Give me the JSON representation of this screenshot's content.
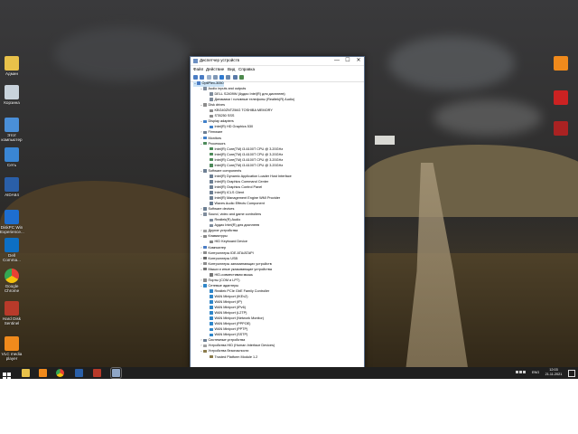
{
  "desktop": {
    "icons": [
      {
        "label": "Админ",
        "icon": "folder-icon",
        "color": "#e8c14a"
      },
      {
        "label": "Корзина",
        "icon": "recycle-bin-icon",
        "color": "#c9d3dc"
      },
      {
        "label": "Этот компьютер",
        "icon": "computer-icon",
        "color": "#4a8fd8"
      },
      {
        "label": "Сеть",
        "icon": "network-icon",
        "color": "#3a86d4"
      },
      {
        "label": "AIDA64",
        "icon": "aida64-icon",
        "color": "#2a5fa8"
      },
      {
        "label": "DiskPC Win Experience...",
        "icon": "diskpc-icon",
        "color": "#1e6ed0"
      },
      {
        "label": "Dell Comma...",
        "icon": "dell-icon",
        "color": "#0d6fc4"
      },
      {
        "label": "Google Chrome",
        "icon": "chrome-icon",
        "color": "#e84234"
      },
      {
        "label": "Hard Disk Sentinel",
        "icon": "hdd-sentinel-icon",
        "color": "#b83a2a"
      },
      {
        "label": "VLC media player",
        "icon": "vlc-icon",
        "color": "#f08a1c"
      }
    ],
    "right_icons": [
      {
        "label": "",
        "icon": "vlc-icon",
        "color": "#f08a1c"
      },
      {
        "label": "",
        "icon": "media-icon",
        "color": "#c22"
      },
      {
        "label": "",
        "icon": "app-icon",
        "color": "#a22"
      }
    ]
  },
  "window": {
    "title": "Диспетчер устройств",
    "menu": [
      "Файл",
      "Действие",
      "Вид",
      "Справка"
    ],
    "controls": {
      "minimize": "—",
      "maximize": "☐",
      "close": "✕"
    },
    "tree": [
      {
        "level": 0,
        "label": "OptiPlex-3050",
        "exp": "⌄",
        "icon": "computer-icon",
        "selected": true
      },
      {
        "level": 1,
        "label": "Audio inputs and outputs",
        "exp": "⌄",
        "icon": "speaker-icon"
      },
      {
        "level": 2,
        "label": "DELL S2409W (Аудио Intel(R) для дисплеев)",
        "exp": "",
        "icon": "speaker-icon"
      },
      {
        "level": 2,
        "label": "Динамики / головные телефоны (Realtek(R) Audio)",
        "exp": "",
        "icon": "speaker-icon"
      },
      {
        "level": 1,
        "label": "Disk drives",
        "exp": "⌄",
        "icon": "disk-icon"
      },
      {
        "level": 2,
        "label": "KBG40ZNT256G TOSHIBA MEMORY",
        "exp": "",
        "icon": "disk-icon"
      },
      {
        "level": 2,
        "label": "ST8250 SSS",
        "exp": "",
        "icon": "disk-icon"
      },
      {
        "level": 1,
        "label": "Display adapters",
        "exp": "⌄",
        "icon": "display-icon"
      },
      {
        "level": 2,
        "label": "Intel(R) HD Graphics 530",
        "exp": "",
        "icon": "display-icon"
      },
      {
        "level": 1,
        "label": "Firmware",
        "exp": "›",
        "icon": "chip-icon"
      },
      {
        "level": 1,
        "label": "Monitors",
        "exp": "›",
        "icon": "monitor-icon"
      },
      {
        "level": 1,
        "label": "Processors",
        "exp": "⌄",
        "icon": "cpu-icon"
      },
      {
        "level": 2,
        "label": "Intel(R) Core(TM) i3-6100T CPU @ 3.20GHz",
        "exp": "",
        "icon": "cpu-icon"
      },
      {
        "level": 2,
        "label": "Intel(R) Core(TM) i3-6100T CPU @ 3.20GHz",
        "exp": "",
        "icon": "cpu-icon"
      },
      {
        "level": 2,
        "label": "Intel(R) Core(TM) i3-6100T CPU @ 3.20GHz",
        "exp": "",
        "icon": "cpu-icon"
      },
      {
        "level": 2,
        "label": "Intel(R) Core(TM) i3-6100T CPU @ 3.20GHz",
        "exp": "",
        "icon": "cpu-icon"
      },
      {
        "level": 1,
        "label": "Software components",
        "exp": "⌄",
        "icon": "chip-icon"
      },
      {
        "level": 2,
        "label": "Intel(R) Dynamic Application Loader Host Interface",
        "exp": "",
        "icon": "chip-icon"
      },
      {
        "level": 2,
        "label": "Intel(R) Graphics Command Center",
        "exp": "",
        "icon": "chip-icon"
      },
      {
        "level": 2,
        "label": "Intel(R) Graphics Control Panel",
        "exp": "",
        "icon": "chip-icon"
      },
      {
        "level": 2,
        "label": "Intel(R) ICLS Client",
        "exp": "",
        "icon": "chip-icon"
      },
      {
        "level": 2,
        "label": "Intel(R) Management Engine WMI Provider",
        "exp": "",
        "icon": "chip-icon"
      },
      {
        "level": 2,
        "label": "Waves Audio Effects Component",
        "exp": "",
        "icon": "chip-icon"
      },
      {
        "level": 1,
        "label": "Software devices",
        "exp": "›",
        "icon": "chip-icon"
      },
      {
        "level": 1,
        "label": "Sound, video and game controllers",
        "exp": "⌄",
        "icon": "speaker-icon"
      },
      {
        "level": 2,
        "label": "Realtek(R) Audio",
        "exp": "",
        "icon": "speaker-icon"
      },
      {
        "level": 2,
        "label": "Аудио Intel(R) для дисплеев",
        "exp": "",
        "icon": "speaker-icon"
      },
      {
        "level": 1,
        "label": "Другие устройства",
        "exp": "›",
        "icon": "device-icon"
      },
      {
        "level": 1,
        "label": "Клавиатуры",
        "exp": "⌄",
        "icon": "keyboard-icon"
      },
      {
        "level": 2,
        "label": "HID Keyboard Device",
        "exp": "",
        "icon": "keyboard-icon"
      },
      {
        "level": 1,
        "label": "Компьютер",
        "exp": "›",
        "icon": "computer-icon"
      },
      {
        "level": 1,
        "label": "Контроллеры IDE ATA/ATAPI",
        "exp": "›",
        "icon": "disk-icon"
      },
      {
        "level": 1,
        "label": "Контроллеры USB",
        "exp": "›",
        "icon": "usb-icon"
      },
      {
        "level": 1,
        "label": "Контроллеры запоминающих устройств",
        "exp": "›",
        "icon": "disk-icon"
      },
      {
        "level": 1,
        "label": "Мыши и иные указывающие устройства",
        "exp": "⌄",
        "icon": "mouse-icon"
      },
      {
        "level": 2,
        "label": "HID-совместимая мышь",
        "exp": "",
        "icon": "mouse-icon"
      },
      {
        "level": 1,
        "label": "Порты (COM и LPT)",
        "exp": "›",
        "icon": "port-icon"
      },
      {
        "level": 1,
        "label": "Сетевые адаптеры",
        "exp": "⌄",
        "icon": "network-icon"
      },
      {
        "level": 2,
        "label": "Realtek PCIe GbE Family Controller",
        "exp": "",
        "icon": "network-icon"
      },
      {
        "level": 2,
        "label": "WAN Miniport (IKEv2)",
        "exp": "",
        "icon": "network-icon"
      },
      {
        "level": 2,
        "label": "WAN Miniport (IP)",
        "exp": "",
        "icon": "network-icon"
      },
      {
        "level": 2,
        "label": "WAN Miniport (IPv6)",
        "exp": "",
        "icon": "network-icon"
      },
      {
        "level": 2,
        "label": "WAN Miniport (L2TP)",
        "exp": "",
        "icon": "network-icon"
      },
      {
        "level": 2,
        "label": "WAN Miniport (Network Monitor)",
        "exp": "",
        "icon": "network-icon"
      },
      {
        "level": 2,
        "label": "WAN Miniport (PPPOE)",
        "exp": "",
        "icon": "network-icon"
      },
      {
        "level": 2,
        "label": "WAN Miniport (PPTP)",
        "exp": "",
        "icon": "network-icon"
      },
      {
        "level": 2,
        "label": "WAN Miniport (SSTP)",
        "exp": "",
        "icon": "network-icon"
      },
      {
        "level": 1,
        "label": "Системные устройства",
        "exp": "›",
        "icon": "chip-icon"
      },
      {
        "level": 1,
        "label": "Устройства HID (Human Interface Devices)",
        "exp": "›",
        "icon": "device-icon"
      },
      {
        "level": 1,
        "label": "Устройства безопасности",
        "exp": "⌄",
        "icon": "security-icon"
      },
      {
        "level": 2,
        "label": "Trusted Platform Module 1.2",
        "exp": "",
        "icon": "security-icon"
      }
    ]
  },
  "taskbar": {
    "apps": [
      {
        "icon": "explorer-icon",
        "color": "#e8c14a"
      },
      {
        "icon": "vlc-icon",
        "color": "#f08a1c"
      },
      {
        "icon": "chrome-icon",
        "color": "#e84234"
      },
      {
        "icon": "aida64-icon",
        "color": "#2a5fa8"
      },
      {
        "icon": "hdd-sentinel-icon",
        "color": "#b83a2a"
      },
      {
        "icon": "device-manager-icon",
        "color": "#8fa6c6"
      }
    ],
    "lang": "ENG",
    "time": "12:03",
    "date": "21.11.2021"
  }
}
